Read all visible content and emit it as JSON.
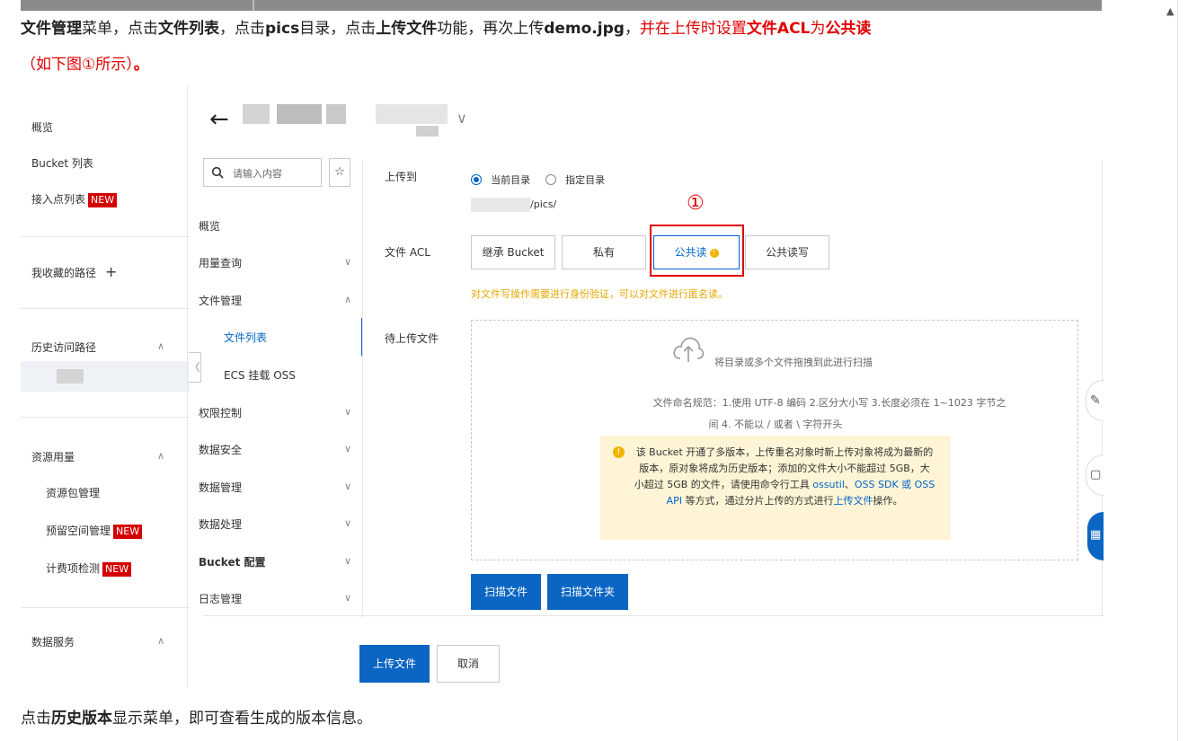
{
  "doc": {
    "line1": {
      "p1_bold": "文件管理",
      "p2": "菜单，点击",
      "p3_bold": "文件列表",
      "p4": "，点击",
      "p5_bold": "pics",
      "p6": "目录，点击",
      "p7_bold": "上传文件",
      "p8": "功能，再次上传",
      "p9_bold": "demo.jpg",
      "p10": "，",
      "p11_red": "并在上传时设置",
      "p12_red_bold": "文件ACL",
      "p13_red": "为",
      "p14_red_bold": "公共读"
    },
    "line2_red": "（如下图①所示）",
    "line2_red_bold": "。",
    "footer": {
      "p1": "点击",
      "p2_bold": "历史版本",
      "p3": "显示菜单，即可查看生成的版本信息。"
    }
  },
  "shot": {
    "left_nav": {
      "overview": "概览",
      "bucket_list": "Bucket 列表",
      "access_points": "接入点列表",
      "new_badge": "NEW",
      "favorites": "我收藏的路径",
      "favorites_add": "+",
      "history": "历史访问路径",
      "resources": "资源用量",
      "resource_pkg": "资源包管理",
      "reserved_space": "预留空间管理",
      "billing_check": "计费项检测",
      "data_service": "数据服务"
    },
    "header": {
      "back": "←",
      "dropdown": "∨"
    },
    "mid_nav": {
      "search_placeholder": "请输入内容",
      "search_icon": "search-icon",
      "star": "☆",
      "collapse": "〈",
      "items": [
        {
          "label": "概览",
          "chevron": ""
        },
        {
          "label": "用量查询",
          "chevron": "∨"
        },
        {
          "label": "文件管理",
          "chevron": "∧"
        },
        {
          "label": "文件列表",
          "chevron": ""
        },
        {
          "label": "ECS 挂载 OSS",
          "chevron": ""
        },
        {
          "label": "权限控制",
          "chevron": "∨"
        },
        {
          "label": "数据安全",
          "chevron": "∨"
        },
        {
          "label": "数据管理",
          "chevron": "∨"
        },
        {
          "label": "数据处理",
          "chevron": "∨"
        },
        {
          "label": "Bucket 配置",
          "chevron": "∨"
        },
        {
          "label": "日志管理",
          "chevron": "∨"
        }
      ]
    },
    "form": {
      "upload_to_label": "上传到",
      "current_dir": "当前目录",
      "specified_dir": "指定目录",
      "path_suffix": "/pics/",
      "acl_label": "文件 ACL",
      "acl_options": [
        "继承 Bucket",
        "私有",
        "公共读",
        "公共读写"
      ],
      "acl_selected": "公共读",
      "acl_marker": "①",
      "acl_warning": "对文件写操作需要进行身份验证，可以对文件进行匿名读。",
      "pending_label": "待上传文件",
      "drop_text": "将目录或多个文件拖拽到此进行扫描",
      "naming_rule_1": "文件命名规范：1.使用 UTF-8 编码 2.区分大小写 3.长度必须在 1~1023 字节之",
      "naming_rule_2": "间 4. 不能以 / 或者 \\ 字符开头",
      "notice_1": "该 Bucket 开通了多版本，上传重名对象时新上传对象将成为最新的",
      "notice_2": "版本，原对象将成为历史版本；添加的文件大小不能超过 5GB，大",
      "notice_3a": "小超过 5GB 的文件，请使用命令行工具 ",
      "notice_3_link1": "ossutil",
      "notice_3b": "、",
      "notice_3_link2": "OSS SDK 或 OSS",
      "notice_4_link": "API",
      "notice_4a": " 等方式，通过分片上传的方式进行",
      "notice_4_link2": "上传文件",
      "notice_4b": "操作。",
      "scan_files": "扫描文件",
      "scan_folder": "扫描文件夹",
      "upload": "上传文件",
      "cancel": "取消"
    },
    "colors": {
      "primary": "#0a66c2",
      "warn_red": "#e00000",
      "notice_bg": "#fff5d6",
      "badge_red": "#d40000"
    }
  }
}
